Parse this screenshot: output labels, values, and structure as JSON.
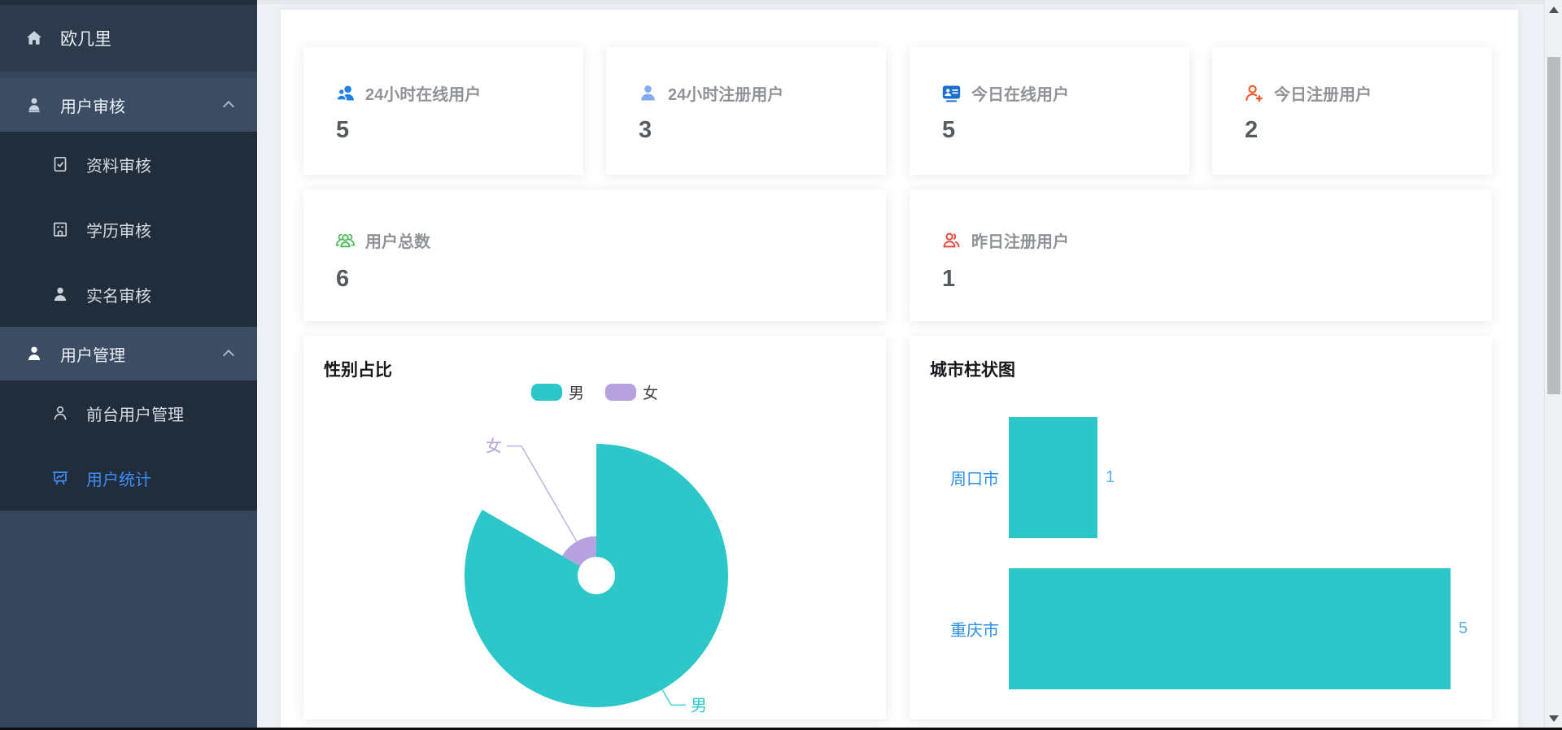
{
  "sidebar": {
    "logo": "欧几里",
    "menu": [
      {
        "label": "用户审核",
        "expanded": true,
        "children": [
          {
            "label": "资料审核"
          },
          {
            "label": "学历审核"
          },
          {
            "label": "实名审核"
          }
        ]
      },
      {
        "label": "用户管理",
        "expanded": true,
        "children": [
          {
            "label": "前台用户管理"
          },
          {
            "label": "用户统计",
            "active": true
          }
        ]
      }
    ],
    "colors": {
      "bg": "#36465c",
      "logo_bg": "#2c3a4b",
      "section_bg": "#3b4c63",
      "submenu_bg": "#222d3c",
      "active_text": "#3e8df7"
    }
  },
  "stats": [
    {
      "label": "24小时在线用户",
      "value": "5",
      "icon": "online-users-24h-icon",
      "icon_color": "#1e80e8"
    },
    {
      "label": "24小时注册用户",
      "value": "3",
      "icon": "registered-users-24h-icon",
      "icon_color": "#83abf2"
    },
    {
      "label": "今日在线用户",
      "value": "5",
      "icon": "today-online-users-icon",
      "icon_color": "#1a6fd0"
    },
    {
      "label": "今日注册用户",
      "value": "2",
      "icon": "today-registered-users-icon",
      "icon_color": "#ed5a2c"
    },
    {
      "label": "用户总数",
      "value": "6",
      "icon": "total-users-icon",
      "icon_color": "#49b857"
    },
    {
      "label": "昨日注册用户",
      "value": "1",
      "icon": "yesterday-registered-users-icon",
      "icon_color": "#e8463c"
    }
  ],
  "chart_data": [
    {
      "type": "pie",
      "style": "rose",
      "title": "性别占比",
      "legend": [
        "男",
        "女"
      ],
      "legend_position": "top-center",
      "series": [
        {
          "name": "男",
          "value": 5
        },
        {
          "name": "女",
          "value": 1
        }
      ],
      "colors": [
        "#2ec7c9",
        "#b6a2de"
      ]
    },
    {
      "type": "bar",
      "title": "城市柱状图",
      "orientation": "horizontal",
      "categories": [
        "周口市",
        "重庆市"
      ],
      "values": [
        1,
        5
      ],
      "xlim": [
        0,
        5
      ],
      "bar_color": "#2ec7c9",
      "category_label_color": "#2f8fe4",
      "value_label_color": "#58b0ec"
    }
  ]
}
